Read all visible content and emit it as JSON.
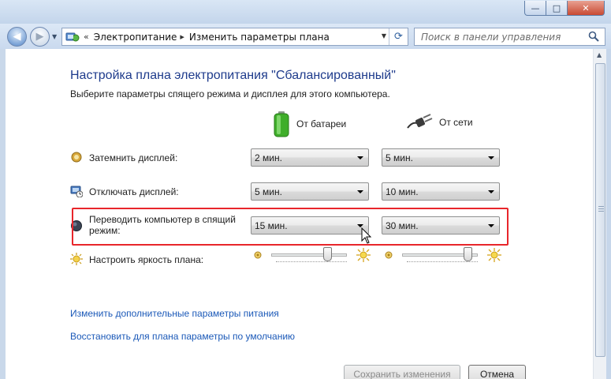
{
  "window": {
    "caption_min": "—",
    "caption_max": "□",
    "caption_close": "✕"
  },
  "nav": {
    "back_glyph": "◀",
    "forward_glyph": "▶",
    "breadcrumb_sep": "«",
    "crumb_1": "Электропитание",
    "crumb_sep": "▸",
    "crumb_2": "Изменить параметры плана",
    "refresh_glyph": "⟳"
  },
  "search": {
    "placeholder": "Поиск в панели управления"
  },
  "page": {
    "title": "Настройка плана электропитания \"Сбалансированный\"",
    "subtitle": "Выберите параметры спящего режима и дисплея для этого компьютера.",
    "col_battery": "От батареи",
    "col_ac": "От сети"
  },
  "rows": [
    {
      "label": "Затемнить дисплей:",
      "battery": "2 мин.",
      "ac": "5 мин.",
      "icon": "dim-display-icon"
    },
    {
      "label": "Отключать дисплей:",
      "battery": "5 мин.",
      "ac": "10 мин.",
      "icon": "turn-off-display-icon"
    },
    {
      "label_line1": "Переводить компьютер в спящий",
      "label_line2": "режим:",
      "battery": "15 мин.",
      "ac": "30 мин.",
      "icon": "sleep-icon"
    }
  ],
  "brightness": {
    "label": "Настроить яркость плана:",
    "battery_level": 0.78,
    "ac_level": 0.92
  },
  "links": {
    "advanced": "Изменить дополнительные параметры питания",
    "restore": "Восстановить для плана параметры по умолчанию"
  },
  "buttons": {
    "save": "Сохранить изменения",
    "cancel": "Отмена"
  },
  "colors": {
    "title_blue": "#1e3b8c",
    "link_blue": "#1b59b8",
    "highlight_red": "#e8262b"
  }
}
